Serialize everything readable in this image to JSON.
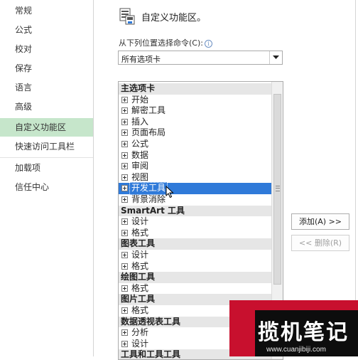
{
  "nav": {
    "items": [
      {
        "label": "常规",
        "selected": false
      },
      {
        "label": "公式",
        "selected": false
      },
      {
        "label": "校对",
        "selected": false
      },
      {
        "label": "保存",
        "selected": false
      },
      {
        "label": "语言",
        "selected": false
      },
      {
        "label": "高级",
        "selected": false
      },
      {
        "label": "自定义功能区",
        "selected": true
      },
      {
        "label": "快速访问工具栏",
        "selected": false
      },
      {
        "label": "加载项",
        "selected": false
      },
      {
        "label": "信任中心",
        "selected": false
      }
    ]
  },
  "header": {
    "title": "自定义功能区。",
    "choose_label": "从下列位置选择命令(C):",
    "info_glyph": "i"
  },
  "dropdown": {
    "value": "所有选项卡"
  },
  "tree": [
    {
      "type": "group",
      "label": "主选项卡"
    },
    {
      "type": "item",
      "label": "开始"
    },
    {
      "type": "item",
      "label": "解密工具"
    },
    {
      "type": "item",
      "label": "插入"
    },
    {
      "type": "item",
      "label": "页面布局"
    },
    {
      "type": "item",
      "label": "公式"
    },
    {
      "type": "item",
      "label": "数据"
    },
    {
      "type": "item",
      "label": "审阅"
    },
    {
      "type": "item",
      "label": "视图"
    },
    {
      "type": "item",
      "label": "开发工具",
      "highlight": true
    },
    {
      "type": "item",
      "label": "背景消除"
    },
    {
      "type": "group",
      "label": "SmartArt 工具"
    },
    {
      "type": "item",
      "label": "设计"
    },
    {
      "type": "item",
      "label": "格式"
    },
    {
      "type": "group",
      "label": "图表工具"
    },
    {
      "type": "item",
      "label": "设计"
    },
    {
      "type": "item",
      "label": "格式"
    },
    {
      "type": "group",
      "label": "绘图工具"
    },
    {
      "type": "item",
      "label": "格式"
    },
    {
      "type": "group",
      "label": "图片工具"
    },
    {
      "type": "item",
      "label": "格式"
    },
    {
      "type": "group",
      "label": "数据透视表工具"
    },
    {
      "type": "item",
      "label": "分析"
    },
    {
      "type": "item",
      "label": "设计"
    },
    {
      "type": "group",
      "label": "工具和工具工具"
    }
  ],
  "buttons": {
    "add": "添加(A) >>",
    "remove": "<< 删除(R)"
  },
  "watermark": {
    "text": "揽机笔记",
    "url": "www.cuanjibiji.com"
  },
  "colors": {
    "nav_selected": "#c6e6cb",
    "tree_highlight": "#2f7ad9",
    "watermark_red": "#c8102e"
  }
}
